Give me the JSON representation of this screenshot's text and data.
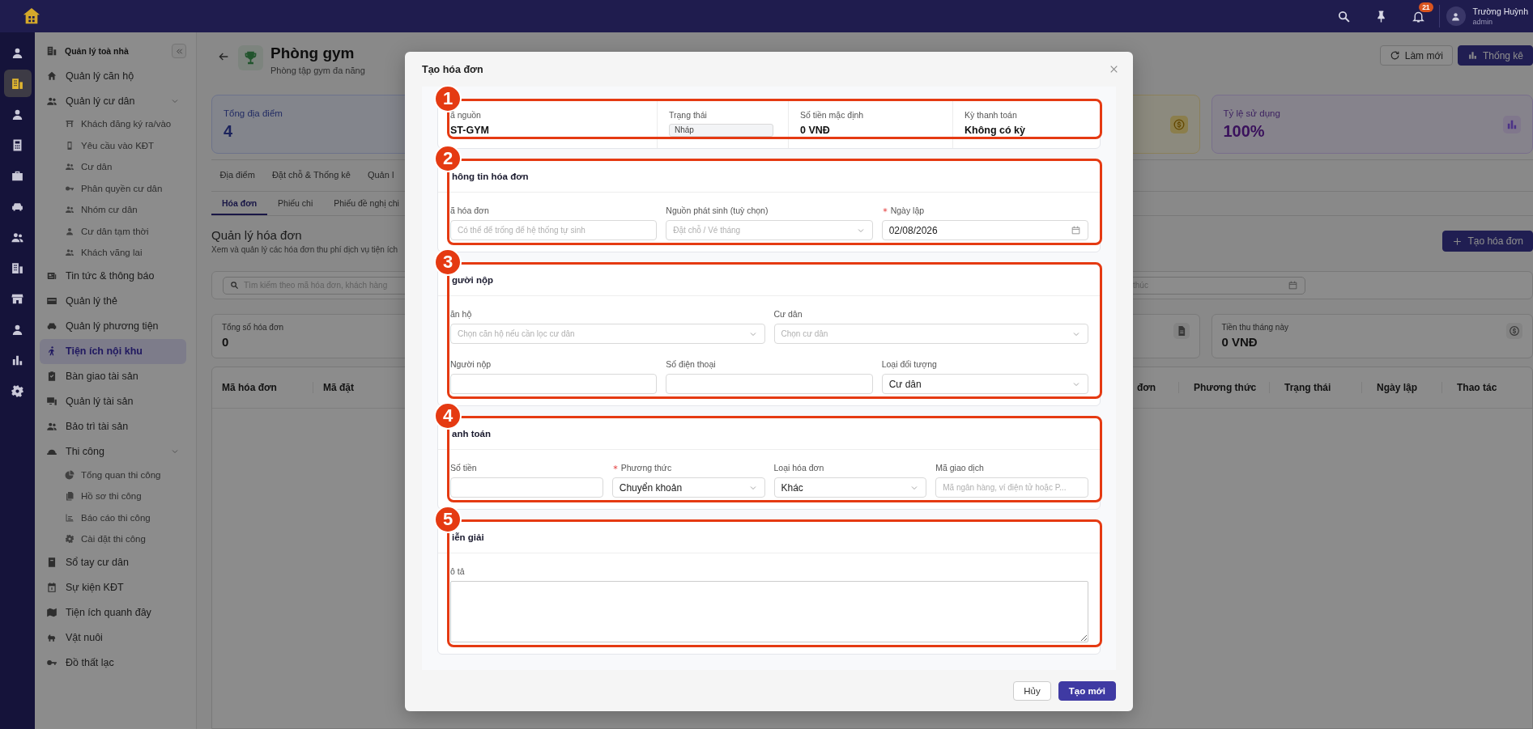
{
  "top_bar": {
    "notification_count": "21",
    "user_name": "Trường Huỳnh",
    "user_role": "admin"
  },
  "rail": [
    {
      "selected": false
    },
    {
      "selected": true
    },
    {
      "selected": false
    },
    {
      "selected": false
    },
    {
      "selected": false
    },
    {
      "selected": false
    },
    {
      "selected": false
    },
    {
      "selected": false
    },
    {
      "selected": false
    },
    {
      "selected": false
    },
    {
      "selected": false
    },
    {
      "selected": false
    }
  ],
  "sidebar": {
    "title": "Quản lý toà nhà",
    "items": [
      {
        "label": "Quản lý căn hộ",
        "selected": false
      },
      {
        "label": "Quản lý cư dân",
        "selected": false,
        "expanded": true,
        "children": [
          {
            "label": "Khách đăng ký ra/vào",
            "selected": false
          },
          {
            "label": "Yêu cầu vào KĐT",
            "selected": false
          },
          {
            "label": "Cư dân",
            "selected": false
          },
          {
            "label": "Phân quyền cư dân",
            "selected": false
          },
          {
            "label": "Nhóm cư dân",
            "selected": false
          },
          {
            "label": "Cư dân tạm thời",
            "selected": false
          },
          {
            "label": "Khách vãng lai",
            "selected": false
          }
        ]
      },
      {
        "label": "Tin tức & thông báo",
        "selected": false
      },
      {
        "label": "Quản lý thẻ",
        "selected": false
      },
      {
        "label": "Quản lý phương tiện",
        "selected": false
      },
      {
        "label": "Tiện ích nội khu",
        "selected": true
      },
      {
        "label": "Bàn giao tài sản",
        "selected": false
      },
      {
        "label": "Quản lý tài sản",
        "selected": false
      },
      {
        "label": "Bảo trì tài sản",
        "selected": false
      },
      {
        "label": "Thi công",
        "selected": false,
        "expanded": true,
        "children": [
          {
            "label": "Tổng quan thi công",
            "selected": false
          },
          {
            "label": "Hồ sơ thi công",
            "selected": false
          },
          {
            "label": "Báo cáo thi công",
            "selected": false
          },
          {
            "label": "Cài đặt thi công",
            "selected": false
          }
        ]
      },
      {
        "label": "Sổ tay cư dân",
        "selected": false
      },
      {
        "label": "Sự kiện KĐT",
        "selected": false
      },
      {
        "label": "Tiện ích quanh đây",
        "selected": false
      },
      {
        "label": "Vật nuôi",
        "selected": false
      },
      {
        "label": "Đồ thất lạc",
        "selected": false
      }
    ]
  },
  "page": {
    "title": "Phòng gym",
    "subtitle": "Phòng tập gym đa năng",
    "refresh_button": "Làm mới",
    "stats_button": "Thống kê"
  },
  "stat_cards": [
    {
      "label": "Tổng địa điểm",
      "value": "4"
    },
    {
      "label": "Tỷ lệ sử dụng",
      "value": "100%"
    }
  ],
  "tabs": [
    {
      "label": "Địa điểm",
      "selected": false
    },
    {
      "label": "Đặt chỗ & Thống kê",
      "selected": false
    },
    {
      "label": "Quản l",
      "selected": false
    }
  ],
  "subtabs": [
    {
      "label": "Hóa đơn",
      "selected": true
    },
    {
      "label": "Phiếu chi",
      "selected": false
    },
    {
      "label": "Phiếu đề nghị chi",
      "selected": false
    }
  ],
  "invoices": {
    "title": "Quản lý hóa đơn",
    "description": "Xem và quản lý các hóa đơn thu phí dịch vụ tiện ích",
    "create_button": "Tạo hóa đơn",
    "search_placeholder": "Tìm kiếm theo mã hóa đơn, khách hàng",
    "date_placeholder": "thúc",
    "summary_cards": [
      {
        "label": "Tổng số hóa đơn",
        "value": "0"
      },
      {
        "label": "Tiền thu tháng này",
        "value": "0 VNĐ"
      }
    ],
    "columns": [
      "Mã hóa đơn",
      "Mã đặt",
      "đơn",
      "Phương thức",
      "Trạng thái",
      "Ngày lập",
      "Thao tác"
    ]
  },
  "modal": {
    "title": "Tạo hóa đơn",
    "summary": {
      "callout": "1",
      "fields": [
        {
          "label": "ã nguồn",
          "value": "ST-GYM",
          "kind": "text"
        },
        {
          "label": "Trạng thái",
          "value": "Nháp",
          "kind": "badge"
        },
        {
          "label": "Số tiền mặc định",
          "value": "0 VNĐ",
          "kind": "text"
        },
        {
          "label": "Kỳ thanh toán",
          "value": "Không có kỳ",
          "kind": "text"
        }
      ]
    },
    "sections": [
      {
        "callout": "2",
        "title": "hông tin hóa đơn",
        "rows": [
          [
            {
              "label": "ã hóa đơn",
              "kind": "input",
              "placeholder": "Có thể để trống để hệ thống tự sinh",
              "required": false
            },
            {
              "label": "Nguồn phát sinh (tuỳ chọn)",
              "kind": "select",
              "placeholder": "Đặt chỗ / Vé tháng",
              "required": false
            },
            {
              "label": "Ngày lập",
              "kind": "date",
              "value": "02/08/2026",
              "required": true
            }
          ]
        ]
      },
      {
        "callout": "3",
        "title": "gười nộp",
        "rows": [
          [
            {
              "label": "ăn hộ",
              "kind": "select",
              "placeholder": "Chọn căn hộ nếu cần lọc cư dân",
              "required": false
            },
            {
              "label": "Cư dân",
              "kind": "select",
              "placeholder": "Chọn cư dân",
              "required": false
            }
          ],
          [
            {
              "label": "Người nộp",
              "kind": "input",
              "required": false
            },
            {
              "label": "Số điện thoại",
              "kind": "input",
              "required": false
            },
            {
              "label": "Loại đối tượng",
              "kind": "select",
              "value": "Cư dân",
              "required": false
            }
          ]
        ]
      },
      {
        "callout": "4",
        "title": "anh toán",
        "rows": [
          [
            {
              "label": "Số tiền",
              "kind": "input",
              "required": false
            },
            {
              "label": "Phương thức",
              "kind": "select",
              "value": "Chuyển khoản",
              "required": true
            },
            {
              "label": "Loại hóa đơn",
              "kind": "select",
              "value": "Khác",
              "required": false
            },
            {
              "label": "Mã giao dịch",
              "kind": "input",
              "placeholder": "Mã ngân hàng, ví điện tử hoặc P...",
              "required": false
            }
          ]
        ]
      },
      {
        "callout": "5",
        "title": "iễn giải",
        "rows": [
          [
            {
              "label": "ô tả",
              "kind": "textarea",
              "required": false
            }
          ]
        ]
      }
    ],
    "buttons": [
      {
        "label": "Hủy",
        "kind": "secondary"
      },
      {
        "label": "Tạo mới",
        "kind": "primary"
      }
    ]
  }
}
